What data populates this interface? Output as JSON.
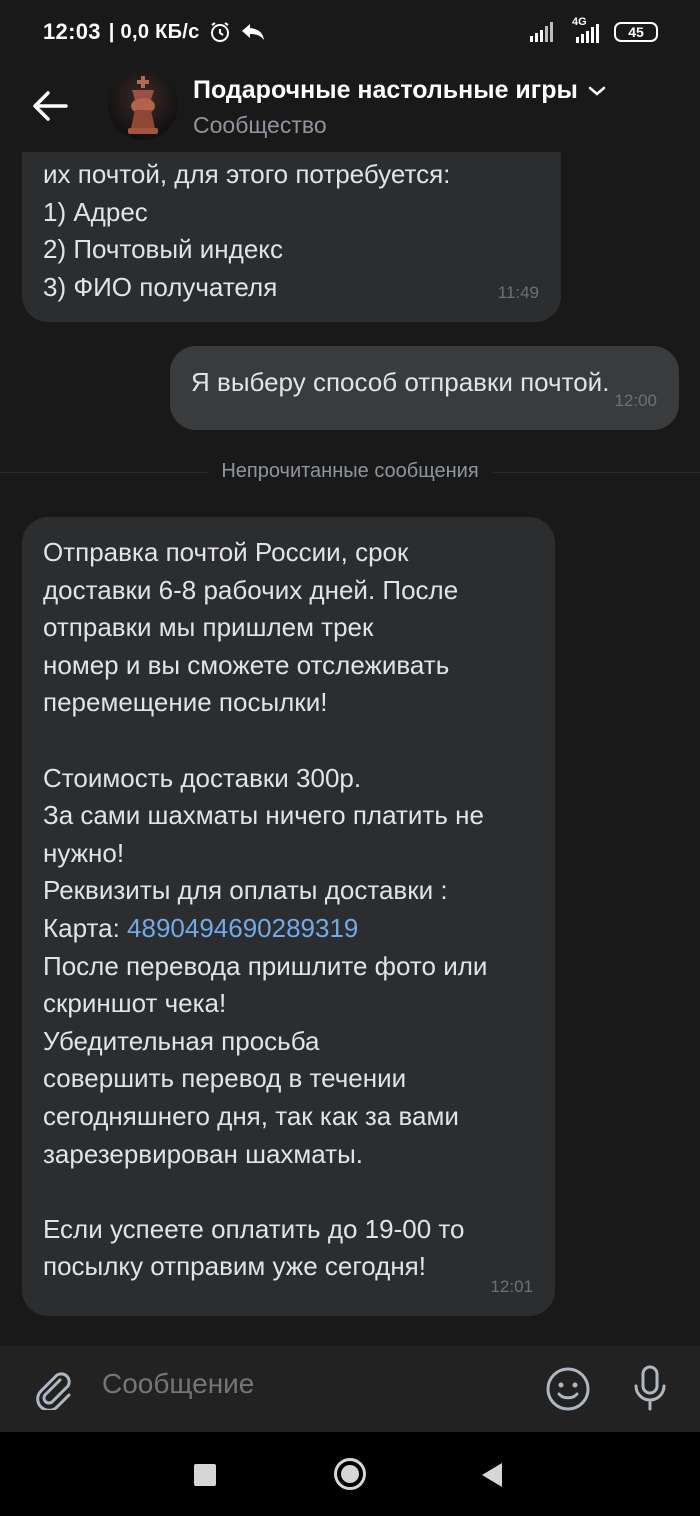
{
  "status_bar": {
    "time": "12:03",
    "net_speed": "| 0,0 КБ/с",
    "network_type": "4G",
    "battery": "45",
    "icons": [
      "alarm-icon",
      "share-arrow-icon",
      "signal-icon",
      "signal-4g-icon",
      "battery-icon"
    ]
  },
  "header": {
    "title": "Подарочные настольные игры",
    "subtitle": "Сообщество"
  },
  "messages": [
    {
      "text": "их почтой, для этого потребуется:\n1) Адрес\n2) Почтовый индекс\n3) ФИО получателя",
      "time": "11:49",
      "direction": "incoming"
    },
    {
      "text": "Я выберу способ отправки почтой.",
      "time": "12:00",
      "direction": "outgoing"
    },
    {
      "text_before_card": "Отправка почтой России, срок\nдоставки 6-8 рабочих дней. После\nотправки мы пришлем трек\nномер и вы сможете отслеживать\nперемещение посылки!\n\nСтоимость доставки 300р.\nЗа сами шахматы ничего платить не\nнужно!\nРеквизиты для оплаты доставки :\nКарта: ",
      "card_number": "4890494690289319",
      "text_after_card": "\nПосле перевода пришлите фото или\nскриншот чека!\nУбедительная просьба\nсовершить перевод в течении\nсегодняшнего дня, так как за вами\nзарезервирован шахматы.\n\nЕсли успеете оплатить до 19-00 то\nпосылку отправим уже сегодня!",
      "time": "12:01",
      "direction": "incoming"
    }
  ],
  "divider": {
    "label": "Непрочитанные сообщения"
  },
  "composer": {
    "placeholder": "Сообщение"
  },
  "colors": {
    "background": "#19191a",
    "bubble_incoming": "#2c2d2e",
    "bubble_outgoing": "#3a3b3c",
    "link": "#71aaeb",
    "secondary_text": "#8f959c"
  }
}
